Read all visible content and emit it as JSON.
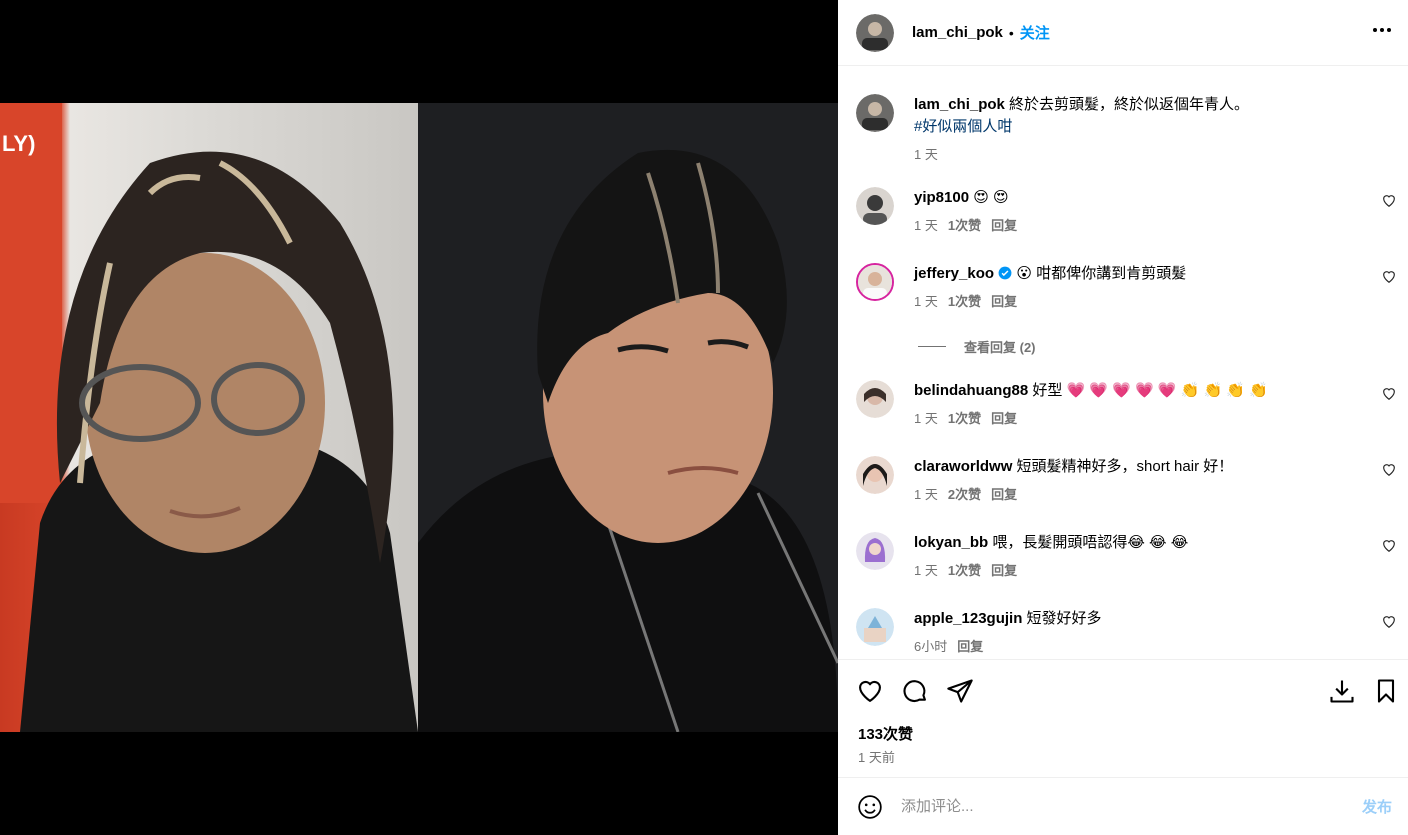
{
  "post": {
    "username": "lam_chi_pok",
    "separator": "•",
    "follow_label": "关注",
    "more_icon": "more-horizontal-icon",
    "caption_text": "終於去剪頭髮，終於似返個年青人。",
    "hashtag": "#好似兩個人咁",
    "caption_time": "1 天"
  },
  "comments": [
    {
      "user": "yip8100",
      "text": "😍 😍",
      "time": "1 天",
      "likes": "1次赞",
      "reply": "回复"
    },
    {
      "user": "jeffery_koo",
      "verified": true,
      "text": "😮 咁都俾你講到肯剪頭髮",
      "time": "1 天",
      "likes": "1次赞",
      "reply": "回复"
    },
    {
      "user": "belindahuang88",
      "text": "好型 💗 💗 💗 💗 💗 👏 👏 👏 👏",
      "time": "1 天",
      "likes": "1次赞",
      "reply": "回复"
    },
    {
      "user": "claraworldww",
      "text": "短頭髮精神好多，short hair 好！",
      "time": "1 天",
      "likes": "2次赞",
      "reply": "回复"
    },
    {
      "user": "lokyan_bb",
      "text": "喂，長髮開頭唔認得😂 😂 😂",
      "time": "1 天",
      "likes": "1次赞",
      "reply": "回复"
    },
    {
      "user": "apple_123gujin",
      "text": "短發好好多",
      "time": "6小时",
      "likes": "",
      "reply": "回复"
    }
  ],
  "view_replies": "查看回复 (2)",
  "actions": {
    "likes": "133次赞",
    "posted": "1 天前"
  },
  "composer": {
    "placeholder": "添加评论...",
    "post_label": "发布"
  },
  "colors": {
    "accent": "#0095f6",
    "muted": "#737373",
    "post_disabled": "#9ccff9",
    "hashtag": "#00376b"
  }
}
